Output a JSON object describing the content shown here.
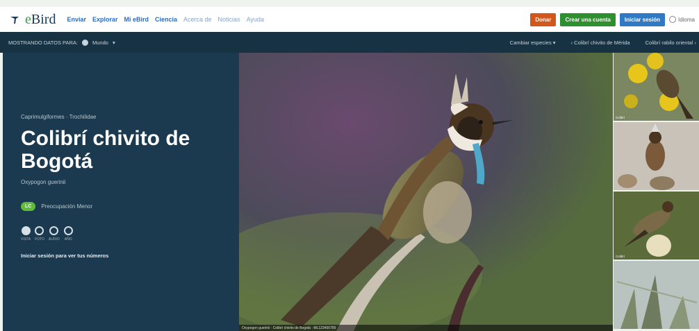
{
  "header": {
    "logo_text_prefix": "e",
    "logo_text_suffix": "Bird",
    "nav": [
      {
        "label": "Enviar",
        "style": "normal"
      },
      {
        "label": "Explorar",
        "style": "bold"
      },
      {
        "label": "Mi eBird",
        "style": "normal"
      },
      {
        "label": "Ciencia",
        "style": "normal"
      },
      {
        "label": "Acerca de",
        "style": "light"
      },
      {
        "label": "Noticias",
        "style": "light"
      },
      {
        "label": "Ayuda",
        "style": "light"
      }
    ],
    "donate_label": "Donar",
    "create_account_label": "Crear una cuenta",
    "sign_in_label": "Iniciar sesión",
    "language_label": "Idioma"
  },
  "subbar": {
    "showing_label": "MOSTRANDO DATOS PARA:",
    "region_label": "Mundo",
    "change_species_label": "Cambiar especies",
    "prev_species_label": "Colibrí chivito de Mérida",
    "next_species_label": "Colibrí rabilo oriental"
  },
  "species": {
    "breadcrumb": "Caprimulgiformes · Trochilidae",
    "common_name": "Colibrí chivito de Bogotá",
    "scientific_name": "Oxypogon guerinii",
    "status_badge": "LC",
    "status_text": "Preocupación Menor",
    "media_labels": [
      "VISTA",
      "FOTO",
      "AUDIO",
      "AÑO"
    ],
    "login_prompt": "Iniciar sesión para ver tus números"
  },
  "photo": {
    "caption": "Oxypogon guerinii · Colibrí chivito de Bogotá · ML123456789"
  },
  "thumbnails": [
    {
      "label": "Colibrí"
    },
    {
      "label": ""
    },
    {
      "label": "Colibrí"
    },
    {
      "label": ""
    }
  ],
  "colors": {
    "panel": "#1b3a4f",
    "subbar": "#163243",
    "donate": "#d2571c",
    "create": "#2e8f2e",
    "signin": "#2f79c5",
    "status_badge": "#5fbc3b"
  }
}
